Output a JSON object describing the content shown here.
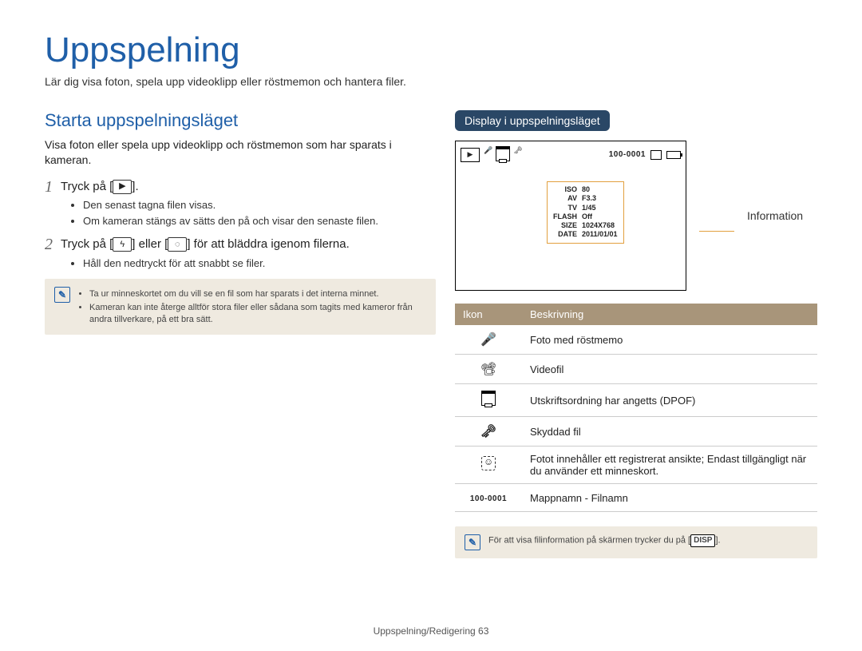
{
  "header": {
    "title": "Uppspelning",
    "lead": "Lär dig visa foton, spela upp videoklipp eller röstmemon och hantera filer."
  },
  "left": {
    "h2": "Starta uppspelningsläget",
    "intro": "Visa foton eller spela upp videoklipp och röstmemon som har sparats i kameran.",
    "step1_num": "1",
    "step1_pre": "Tryck på [",
    "step1_post": "].",
    "step1_b1": "Den senast tagna filen visas.",
    "step1_b2": "Om kameran stängs av sätts den på och visar den senaste filen.",
    "step2_num": "2",
    "step2_pre": "Tryck på [",
    "step2_mid": "] eller [",
    "step2_post": "] för att bläddra igenom filerna.",
    "step2_b1": "Håll den nedtryckt för att snabbt se filer.",
    "note1": "Ta ur minneskortet om du vill se en fil som har sparats i det interna minnet.",
    "note2": "Kameran kan inte återge alltför stora filer eller sådana som tagits med kameror från andra tillverkare, på ett bra sätt."
  },
  "right": {
    "pill": "Display i uppspelningsläget",
    "folder": "100-0001",
    "info_label": "Information",
    "info": {
      "iso_l": "ISO",
      "iso_v": "80",
      "av_l": "AV",
      "av_v": "F3.3",
      "tv_l": "TV",
      "tv_v": "1/45",
      "flash_l": "FLASH",
      "flash_v": "Off",
      "size_l": "SIZE",
      "size_v": "1024X768",
      "date_l": "DATE",
      "date_v": "2011/01/01"
    },
    "th_icon": "Ikon",
    "th_desc": "Beskrivning",
    "rows": {
      "r1": "Foto med röstmemo",
      "r2": "Videofil",
      "r3": "Utskriftsordning har angetts (DPOF)",
      "r4": "Skyddad fil",
      "r5": "Fotot innehåller ett registrerat ansikte; Endast tillgängligt när du använder ett minneskort.",
      "r6": "Mappnamn - Filnamn",
      "r6_icon": "100-0001"
    },
    "note": "För att visa filinformation på skärmen trycker du på [",
    "note_post": "].",
    "disp": "DISP"
  },
  "footer": {
    "text": "Uppspelning/Redigering",
    "page": "63"
  }
}
